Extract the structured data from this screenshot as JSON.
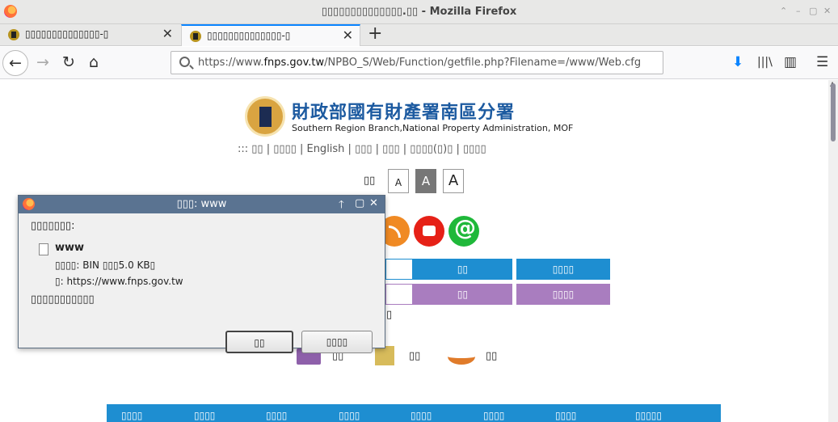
{
  "window": {
    "title": "▯▯▯▯▯▯▯▯▯▯▯▯▯▯.▯▯ - Mozilla Firefox",
    "controls": [
      "⌃",
      "–",
      "▢",
      "✕"
    ]
  },
  "tabs": [
    {
      "title": "▯▯▯▯▯▯▯▯▯▯▯▯▯▯-▯",
      "close": "✕"
    },
    {
      "title": "▯▯▯▯▯▯▯▯▯▯▯▯▯▯-▯",
      "close": "✕"
    }
  ],
  "new_tab": "+",
  "nav": {
    "back": "←",
    "forward": "→",
    "reload": "↻",
    "home": "⌂",
    "url_prefix": "https://www.",
    "url_domain": "fnps.gov.tw",
    "url_path": "/NPBO_S/Web/Function/getfile.php?Filename=/www/Web.cfg",
    "download": "⬇",
    "library": "|||\\",
    "sidebar": "▥",
    "menu": "☰"
  },
  "site": {
    "title": "財政部國有財產署南區分署",
    "subtitle": "Southern Region Branch,National Property Administration, MOF",
    "topnav": "::: ▯▯ | ▯▯▯▯ | English | ▯▯▯ | ▯▯▯ | ▯▯▯▯(▯)▯ | ▯▯▯▯",
    "fontsize_label": "▯▯",
    "fontsize_buttons": [
      "A",
      "A",
      "A"
    ],
    "buttons_blue": [
      "▯▯",
      "▯▯▯▯"
    ],
    "buttons_purple": [
      "▯▯",
      "▯▯▯▯"
    ],
    "partial_text": "▯",
    "quick_labels": [
      "▯▯",
      "▯▯",
      "▯▯"
    ],
    "menu_items": [
      "▯▯▯▯",
      "▯▯▯▯",
      "▯▯▯▯",
      "▯▯▯▯",
      "▯▯▯▯",
      "▯▯▯▯",
      "▯▯▯▯",
      "▯▯▯▯▯"
    ]
  },
  "dialog": {
    "title": "▯▯▯: www",
    "controls": [
      "🡑",
      "▢",
      "✕"
    ],
    "prompt": "▯▯▯▯▯▯▯:",
    "filename": "www",
    "file_info": "▯▯▯▯: BIN ▯▯▯5.0 KB▯",
    "from_label": "▯: https://www.fnps.gov.tw",
    "question": "▯▯▯▯▯▯▯▯▯▯▯",
    "ok_button": "▯▯",
    "cancel_button": "▯▯▯▯"
  }
}
